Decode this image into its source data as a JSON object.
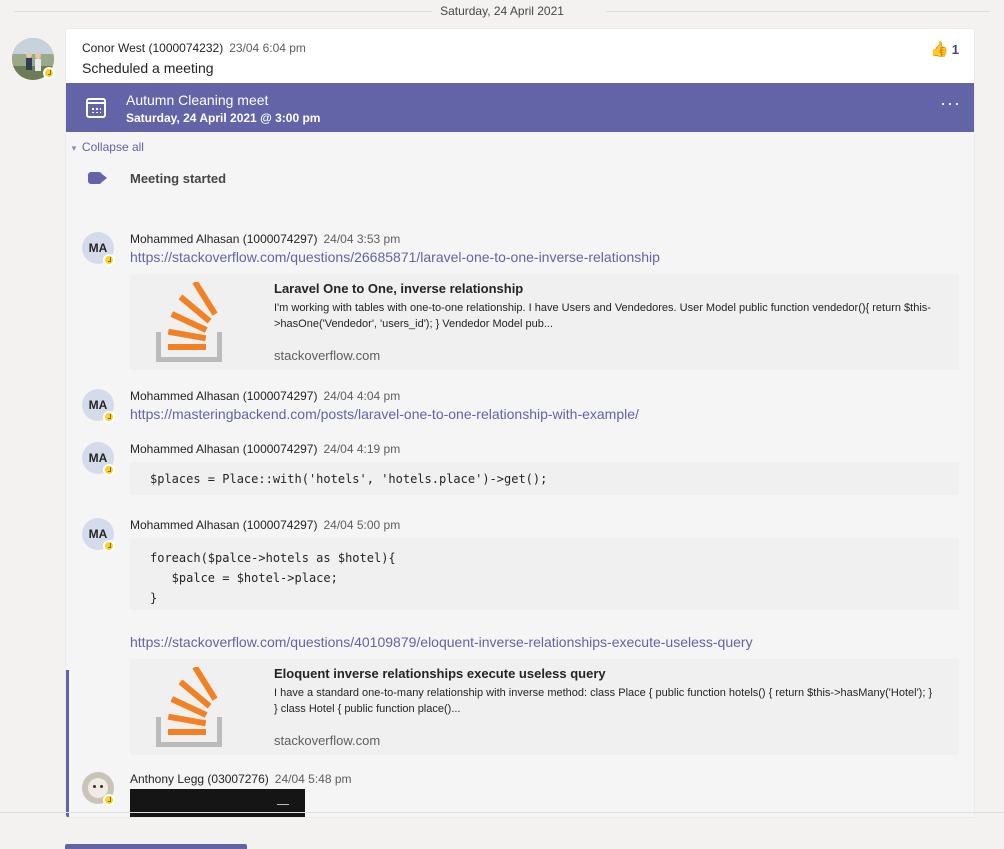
{
  "date_divider": "Saturday, 24 April 2021",
  "colors": {
    "accent": "#6264a7",
    "status_away": "#f8d22a",
    "link": "#6264a7",
    "so_orange": "#f48024",
    "so_gray": "#bcbbbb"
  },
  "post": {
    "author": "Conor West (1000074232)",
    "timestamp": "23/04 6:04 pm",
    "text": "Scheduled a meeting",
    "reaction": {
      "icon": "thumbs-up-icon",
      "count": "1"
    }
  },
  "meeting": {
    "title": "Autumn Cleaning meet",
    "datetime": "Saturday, 24 April 2021 @ 3:00 pm",
    "more_label": "···"
  },
  "thread": {
    "collapse_label": "Collapse all",
    "meeting_started": "Meeting started",
    "replies": [
      {
        "initials": "MA",
        "author": "Mohammed Alhasan (1000074297)",
        "timestamp": "24/04 3:53 pm",
        "link": "https://stackoverflow.com/questions/26685871/laravel-one-to-one-inverse-relationship",
        "preview": {
          "title": "Laravel One to One, inverse relationship",
          "description": "I'm working with tables with one-to-one relationship. I have Users and Vendedores. User Model public function vendedor(){ return $this->hasOne('Vendedor', 'users_id'); } Vendedor Model pub...",
          "domain": "stackoverflow.com"
        }
      },
      {
        "initials": "MA",
        "author": "Mohammed Alhasan (1000074297)",
        "timestamp": "24/04 4:04 pm",
        "link": "https://masteringbackend.com/posts/laravel-one-to-one-relationship-with-example/"
      },
      {
        "initials": "MA",
        "author": "Mohammed Alhasan (1000074297)",
        "timestamp": "24/04 4:19 pm",
        "code": "$places = Place::with('hotels', 'hotels.place')->get();"
      },
      {
        "initials": "MA",
        "author": "Mohammed Alhasan (1000074297)",
        "timestamp": "24/04 5:00 pm",
        "code": "foreach($palce->hotels as $hotel){\n   $palce = $hotel->place;\n}",
        "link": "https://stackoverflow.com/questions/40109879/eloquent-inverse-relationships-execute-useless-query",
        "preview": {
          "title": "Eloquent inverse relationships execute useless query",
          "description": "I have a standard one-to-many relationship with inverse method: class Place { public function hotels() { return $this->hasMany('Hotel'); } } class Hotel { public function place()...",
          "domain": "stackoverflow.com"
        }
      },
      {
        "author": "Anthony Legg (03007276)",
        "timestamp": "24/04 5:48 pm"
      }
    ]
  }
}
